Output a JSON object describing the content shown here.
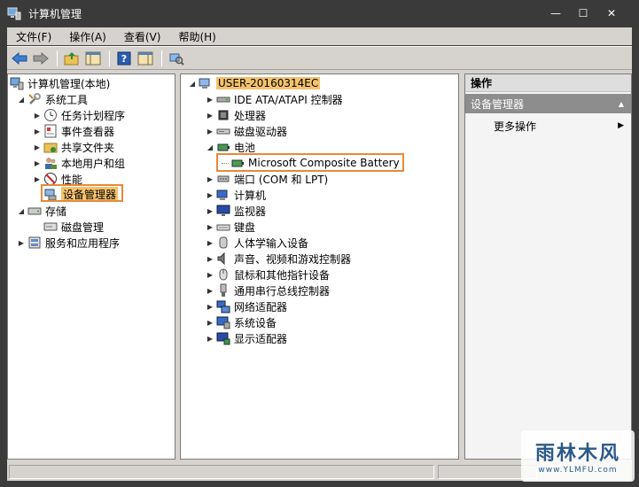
{
  "window": {
    "title": "计算机管理",
    "controls": {
      "minimize": "—",
      "maximize": "☐",
      "close": "✕"
    }
  },
  "menubar": {
    "items": [
      "文件(F)",
      "操作(A)",
      "查看(V)",
      "帮助(H)"
    ]
  },
  "left_tree": {
    "items": [
      {
        "label": "计算机管理(本地)",
        "icon": "computer-management-icon"
      },
      {
        "label": "系统工具",
        "icon": "tools-icon"
      },
      {
        "label": "任务计划程序",
        "icon": "clock-icon"
      },
      {
        "label": "事件查看器",
        "icon": "event-viewer-icon"
      },
      {
        "label": "共享文件夹",
        "icon": "shared-folder-icon"
      },
      {
        "label": "本地用户和组",
        "icon": "users-icon"
      },
      {
        "label": "性能",
        "icon": "performance-icon"
      },
      {
        "label": "设备管理器",
        "icon": "device-manager-icon"
      },
      {
        "label": "存储",
        "icon": "storage-icon"
      },
      {
        "label": "磁盘管理",
        "icon": "disk-management-icon"
      },
      {
        "label": "服务和应用程序",
        "icon": "services-icon"
      }
    ]
  },
  "device_tree": {
    "root": "USER-20160314EC",
    "items": [
      {
        "label": "IDE ATA/ATAPI 控制器",
        "icon": "ide-controller-icon"
      },
      {
        "label": "处理器",
        "icon": "processor-icon"
      },
      {
        "label": "磁盘驱动器",
        "icon": "disk-drive-icon"
      },
      {
        "label": "电池",
        "icon": "battery-icon"
      },
      {
        "label": "Microsoft Composite Battery",
        "icon": "battery-device-icon"
      },
      {
        "label": "端口 (COM 和 LPT)",
        "icon": "port-icon"
      },
      {
        "label": "计算机",
        "icon": "computer-icon"
      },
      {
        "label": "监视器",
        "icon": "monitor-icon"
      },
      {
        "label": "键盘",
        "icon": "keyboard-icon"
      },
      {
        "label": "人体学输入设备",
        "icon": "hid-icon"
      },
      {
        "label": "声音、视频和游戏控制器",
        "icon": "sound-icon"
      },
      {
        "label": "鼠标和其他指针设备",
        "icon": "mouse-icon"
      },
      {
        "label": "通用串行总线控制器",
        "icon": "usb-icon"
      },
      {
        "label": "网络适配器",
        "icon": "network-adapter-icon"
      },
      {
        "label": "系统设备",
        "icon": "system-device-icon"
      },
      {
        "label": "显示适配器",
        "icon": "display-adapter-icon"
      }
    ]
  },
  "actions": {
    "header": "操作",
    "section": "设备管理器",
    "more": "更多操作"
  },
  "watermark": {
    "main": "雨林木风",
    "url": "www.YLMFU.com"
  },
  "colors": {
    "highlight": "#e58a3a",
    "selection": "#f5c26b"
  }
}
